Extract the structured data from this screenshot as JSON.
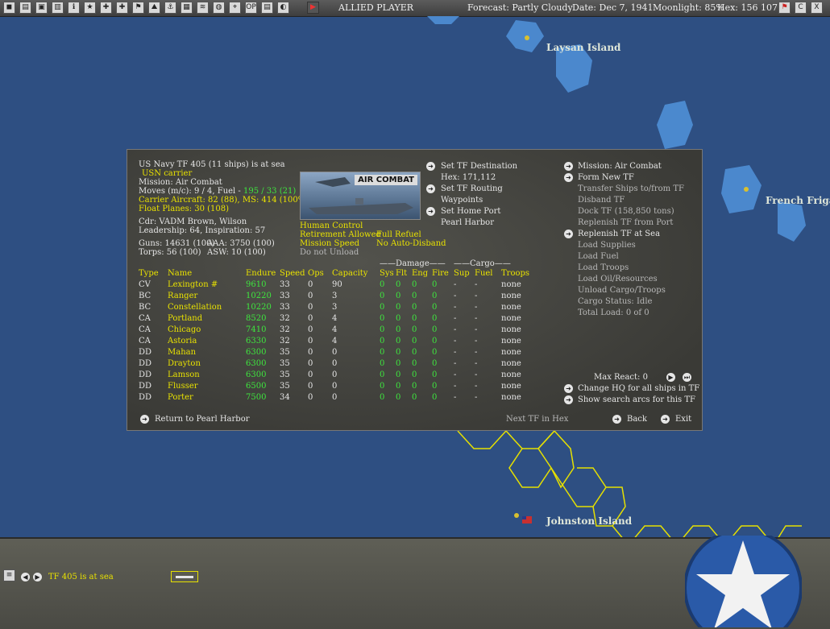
{
  "topbar": {
    "side": "ALLIED PLAYER",
    "forecast": "Forecast: Partly Cloudy",
    "date": "Date: Dec 7, 1941",
    "moonlight": "Moonlight: 85%",
    "hex": "Hex: 156 107",
    "right_buttons": [
      "flag-icon",
      "C",
      "X"
    ]
  },
  "map": {
    "laysan": "Laysan Island",
    "french": "French Friga",
    "johnston": "Johnston Island"
  },
  "tf": {
    "header": "US Navy TF 405 (11 ships) is at sea",
    "type": "USN carrier",
    "mission": "Mission: Air Combat",
    "moves_prefix": "Moves (m/c): 9 / 4, Fuel - ",
    "moves_fuel": "195 / 33 (21)",
    "carrier_aircraft": "Carrier Aircraft: 82 (88), MS: 414 (100%)",
    "float_planes": "Float Planes: 30 (108)",
    "cdr": "Cdr: VADM Brown, Wilson",
    "leadership": "Leadership: 64, Inspiration: 57",
    "guns": "Guns: 14631 (100)",
    "aaa": "AAA: 3750 (100)",
    "torps": "Torps: 56 (100)",
    "asw": "ASW: 10 (100)",
    "image_label": "AIR COMBAT",
    "human_control": "Human Control",
    "retirement": "Retirement Allowed",
    "full_refuel": "Full Refuel",
    "mission_speed": "Mission Speed",
    "no_auto_disband": "No Auto-Disband",
    "do_not_unload": "Do not Unload"
  },
  "nav": {
    "set_dest": "Set TF Destination",
    "hex_dest": "Hex: 171,112",
    "set_routing": "Set TF Routing",
    "waypoints": "Waypoints",
    "set_home": "Set Home Port",
    "home_port": "Pearl Harbor"
  },
  "actions": {
    "mission": "Mission: Air Combat",
    "form_new": "Form New TF",
    "transfer": "Transfer Ships to/from TF",
    "disband": "Disband TF",
    "dock": "Dock TF (158,850 tons)",
    "replenish_port": "Replenish TF from Port",
    "replenish_sea": "Replenish TF at Sea",
    "load_supplies": "Load Supplies",
    "load_fuel": "Load Fuel",
    "load_troops": "Load Troops",
    "load_oil": "Load Oil/Resources",
    "unload": "Unload Cargo/Troops",
    "cargo_status": "Cargo Status: Idle",
    "total_load": "Total Load: 0 of 0",
    "max_react": "Max React: 0",
    "change_hq": "Change HQ for all ships in TF",
    "show_arcs": "Show search arcs for this TF"
  },
  "footer": {
    "return": "Return to Pearl Harbor",
    "next_tf": "Next TF in Hex",
    "back": "Back",
    "exit": "Exit"
  },
  "table": {
    "group_damage": "Damage",
    "group_cargo": "Cargo",
    "headers": [
      "Type",
      "Name",
      "Endure",
      "Speed",
      "Ops",
      "Capacity",
      "Sys",
      "Flt",
      "Eng",
      "Fire",
      "Sup",
      "Fuel",
      "Troops"
    ],
    "rows": [
      [
        "CV",
        "Lexington #",
        "9610",
        "33",
        "0",
        "90",
        "0",
        "0",
        "0",
        "0",
        "-",
        "-",
        "none"
      ],
      [
        "BC",
        "Ranger",
        "10220",
        "33",
        "0",
        "3",
        "0",
        "0",
        "0",
        "0",
        "-",
        "-",
        "none"
      ],
      [
        "BC",
        "Constellation",
        "10220",
        "33",
        "0",
        "3",
        "0",
        "0",
        "0",
        "0",
        "-",
        "-",
        "none"
      ],
      [
        "CA",
        "Portland",
        "8520",
        "32",
        "0",
        "4",
        "0",
        "0",
        "0",
        "0",
        "-",
        "-",
        "none"
      ],
      [
        "CA",
        "Chicago",
        "7410",
        "32",
        "0",
        "4",
        "0",
        "0",
        "0",
        "0",
        "-",
        "-",
        "none"
      ],
      [
        "CA",
        "Astoria",
        "6330",
        "32",
        "0",
        "4",
        "0",
        "0",
        "0",
        "0",
        "-",
        "-",
        "none"
      ],
      [
        "DD",
        "Mahan",
        "6300",
        "35",
        "0",
        "0",
        "0",
        "0",
        "0",
        "0",
        "-",
        "-",
        "none"
      ],
      [
        "DD",
        "Drayton",
        "6300",
        "35",
        "0",
        "0",
        "0",
        "0",
        "0",
        "0",
        "-",
        "-",
        "none"
      ],
      [
        "DD",
        "Lamson",
        "6300",
        "35",
        "0",
        "0",
        "0",
        "0",
        "0",
        "0",
        "-",
        "-",
        "none"
      ],
      [
        "DD",
        "Flusser",
        "6500",
        "35",
        "0",
        "0",
        "0",
        "0",
        "0",
        "0",
        "-",
        "-",
        "none"
      ],
      [
        "DD",
        "Porter",
        "7500",
        "34",
        "0",
        "0",
        "0",
        "0",
        "0",
        "0",
        "-",
        "-",
        "none"
      ]
    ]
  },
  "bottom": {
    "status": "TF 405 is at sea"
  }
}
